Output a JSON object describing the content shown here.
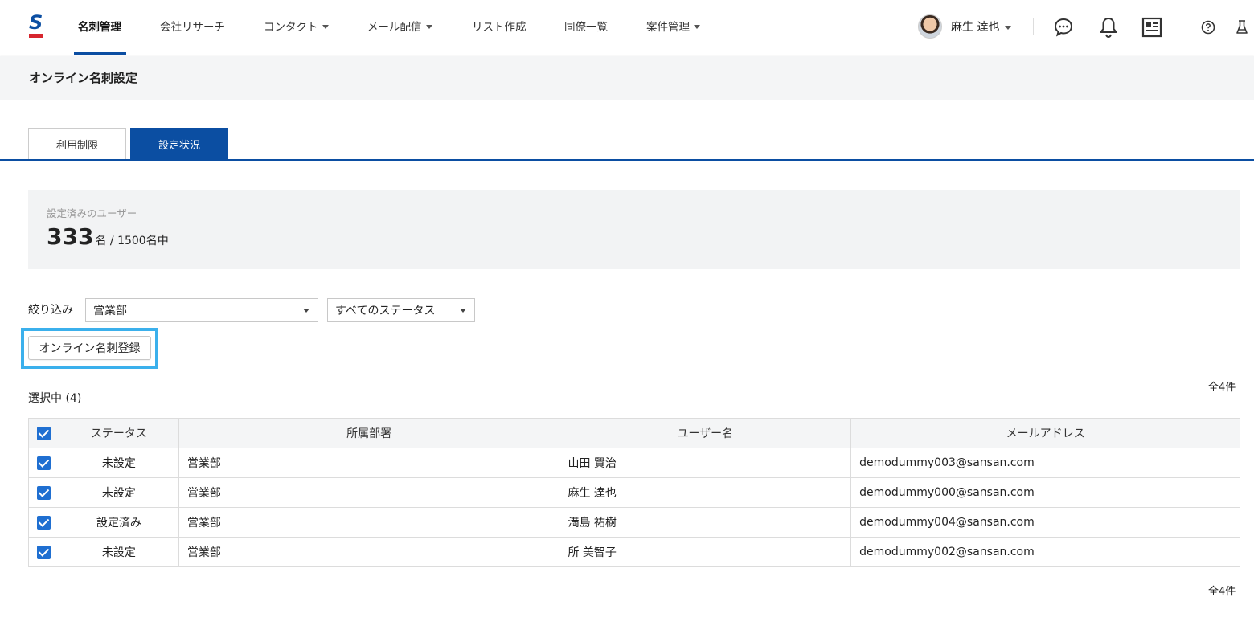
{
  "nav": {
    "items": [
      {
        "label": "名刺管理",
        "dropdown": false
      },
      {
        "label": "会社リサーチ",
        "dropdown": false
      },
      {
        "label": "コンタクト",
        "dropdown": true
      },
      {
        "label": "メール配信",
        "dropdown": true
      },
      {
        "label": "リスト作成",
        "dropdown": false
      },
      {
        "label": "同僚一覧",
        "dropdown": false
      },
      {
        "label": "案件管理",
        "dropdown": true
      }
    ],
    "user_name": "麻生 達也",
    "icons": [
      "chat-icon",
      "bell-icon",
      "card-icon",
      "help-icon",
      "flask-icon"
    ]
  },
  "page": {
    "title": "オンライン名刺設定"
  },
  "tabs": [
    {
      "label": "利用制限",
      "active": false
    },
    {
      "label": "設定状況",
      "active": true
    }
  ],
  "summary": {
    "label": "設定済みのユーザー",
    "count": "333",
    "rest": "名 / 1500名中"
  },
  "filter": {
    "label": "絞り込み",
    "department": "営業部",
    "status": "すべてのステータス"
  },
  "register_button": "オンライン名刺登録",
  "selected_text": "選択中 (4)",
  "total_text": "全4件",
  "table": {
    "headers": [
      "ステータス",
      "所属部署",
      "ユーザー名",
      "メールアドレス"
    ],
    "rows": [
      {
        "status": "未設定",
        "department": "営業部",
        "user": "山田 賢治",
        "email": "demodummy003@sansan.com",
        "checked": true
      },
      {
        "status": "未設定",
        "department": "営業部",
        "user": "麻生 達也",
        "email": "demodummy000@sansan.com",
        "checked": true
      },
      {
        "status": "設定済み",
        "department": "営業部",
        "user": "満島 祐樹",
        "email": "demodummy004@sansan.com",
        "checked": true
      },
      {
        "status": "未設定",
        "department": "営業部",
        "user": "所 美智子",
        "email": "demodummy002@sansan.com",
        "checked": true
      }
    ]
  },
  "colors": {
    "brand": "#0b4ea2",
    "logo_red": "#d7262e",
    "unset_status": "#d7262e",
    "highlight": "#3bb0ec",
    "checkbox": "#1f6fd1"
  }
}
